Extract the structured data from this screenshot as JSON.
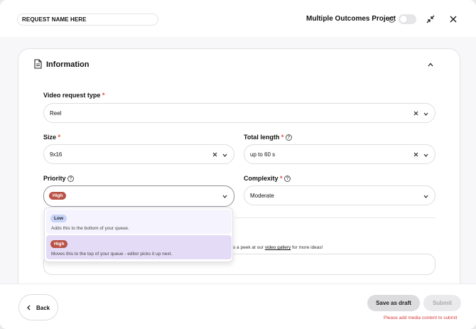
{
  "header": {
    "request_name": "REQUEST NAME HERE",
    "multiple_outcomes_label": "Multiple Outcomes Project",
    "toggle_on": false
  },
  "section": {
    "title": "Information"
  },
  "fields": {
    "video_request_type": {
      "label": "Video request type",
      "value": "Reel"
    },
    "size": {
      "label": "Size",
      "value": "9x16"
    },
    "total_length": {
      "label": "Total length",
      "value": "up to 60 s"
    },
    "priority": {
      "label": "Priority",
      "value": "High"
    },
    "complexity": {
      "label": "Complexity",
      "value": "Moderate"
    }
  },
  "priority_options": [
    {
      "label": "Low",
      "description": "Adds this to the bottom of your queue."
    },
    {
      "label": "High",
      "description": "Moves this to the top of your queue - editor picks it up next."
    }
  ],
  "peek": {
    "prefix": "s a peek at our ",
    "link": "video gallery",
    "suffix": " for more ideas!"
  },
  "footer": {
    "back_label": "Back",
    "save_draft_label": "Save as draft",
    "submit_label": "Submit",
    "error_text": "Please add media content to submit"
  },
  "colors": {
    "required": "#e0492f",
    "badge_high": "#b95347",
    "badge_low": "#c7d4f3",
    "error": "#d63b3b"
  }
}
